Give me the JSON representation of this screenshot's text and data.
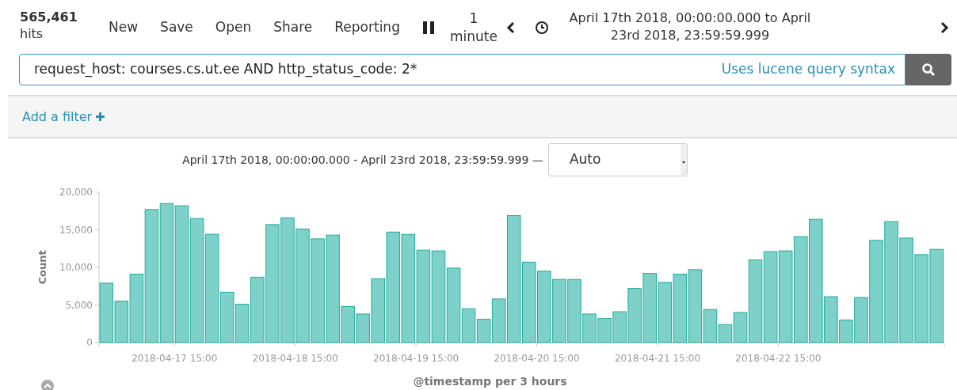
{
  "hits": {
    "count": "565,461",
    "label": "hits"
  },
  "menu": [
    {
      "label": "New"
    },
    {
      "label": "Save"
    },
    {
      "label": "Open"
    },
    {
      "label": "Share"
    },
    {
      "label": "Reporting"
    }
  ],
  "refresh_interval": "1 minute",
  "time_range": "April 17th 2018, 00:00:00.000 to April 23rd 2018, 23:59:59.999",
  "query": {
    "value": "request_host: courses.cs.ut.ee AND http_status_code: 2*",
    "hint": "Uses lucene query syntax"
  },
  "filter_bar": {
    "add_filter": "Add a filter"
  },
  "histogram": {
    "range_label": "April 17th 2018, 00:00:00.000 - April 23rd 2018, 23:59:59.999 —",
    "interval": "Auto",
    "chart_data": {
      "type": "bar",
      "xlabel": "@timestamp per 3 hours",
      "ylabel": "Count",
      "ylim": [
        0,
        20000
      ],
      "categories": [
        null,
        null,
        null,
        null,
        null,
        "2018-04-17 15:00",
        null,
        null,
        null,
        null,
        null,
        null,
        null,
        "2018-04-18 15:00",
        null,
        null,
        null,
        null,
        null,
        null,
        null,
        "2018-04-19 15:00",
        null,
        null,
        null,
        null,
        null,
        null,
        null,
        "2018-04-20 15:00",
        null,
        null,
        null,
        null,
        null,
        null,
        null,
        "2018-04-21 15:00",
        null,
        null,
        null,
        null,
        null,
        null,
        null,
        "2018-04-22 15:00",
        null,
        null,
        null,
        null,
        null,
        null,
        null,
        null,
        null,
        null
      ],
      "series": [
        {
          "color": "#7dd1c9",
          "values": [
            7900,
            5500,
            9100,
            17700,
            18500,
            18200,
            16500,
            14400,
            6700,
            5100,
            8700,
            15700,
            16600,
            15100,
            13800,
            14300,
            4800,
            3800,
            8500,
            14700,
            14400,
            12300,
            12200,
            9900,
            4500,
            3100,
            5800,
            16900,
            10700,
            9500,
            8400,
            8400,
            3800,
            3200,
            4100,
            7200,
            9200,
            8000,
            9100,
            9700,
            4400,
            2400,
            4000,
            11000,
            12100,
            12200,
            14100,
            16400,
            6100,
            3000,
            6000,
            13600,
            16100,
            13900,
            11700,
            12400
          ]
        }
      ],
      "yticks": [
        {
          "value": 0,
          "label": "0"
        },
        {
          "value": 5000,
          "label": "5,000"
        },
        {
          "value": 10000,
          "label": "10,000"
        },
        {
          "value": 15000,
          "label": "15,000"
        },
        {
          "value": 20000,
          "label": "20,000"
        }
      ]
    }
  }
}
